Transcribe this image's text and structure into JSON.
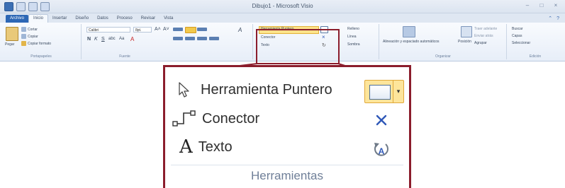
{
  "window": {
    "title": "Dibujo1 - Microsoft Visio"
  },
  "tabs": [
    {
      "label": "Archivo"
    },
    {
      "label": "Inicio"
    },
    {
      "label": "Insertar"
    },
    {
      "label": "Diseño"
    },
    {
      "label": "Datos"
    },
    {
      "label": "Proceso"
    },
    {
      "label": "Revisar"
    },
    {
      "label": "Vista"
    }
  ],
  "ribbon": {
    "clipboard": {
      "paste": "Pegar",
      "cut": "Cortar",
      "copy": "Copiar",
      "format_painter": "Copiar formato",
      "label": "Portapapeles"
    },
    "font": {
      "font_name": "Calibri",
      "font_size": "8pt.",
      "label": "Fuente"
    },
    "tools_small": {
      "pointer": "Herramienta Puntero",
      "connector": "Conector",
      "text": "Texto"
    },
    "shape": {
      "fill": "Relleno",
      "line": "Línea",
      "shadow": "Sombra"
    },
    "arrange": {
      "align": "Alineación y espaciado automáticos",
      "position": "Posición",
      "bring_front": "Traer adelante",
      "send_back": "Enviar atrás",
      "group": "Agrupar",
      "label": "Organizar"
    },
    "editing": {
      "find": "Buscar",
      "layers": "Capas",
      "select": "Seleccionar",
      "label": "Edición"
    }
  },
  "zoom": {
    "pointer_label": "Herramienta Puntero",
    "connector_label": "Conector",
    "text_label": "Texto",
    "group_name": "Herramientas"
  },
  "colors": {
    "highlight_border": "#8b1d2c",
    "tool_highlight": "#fde59b",
    "close_x": "#2f58b8"
  }
}
